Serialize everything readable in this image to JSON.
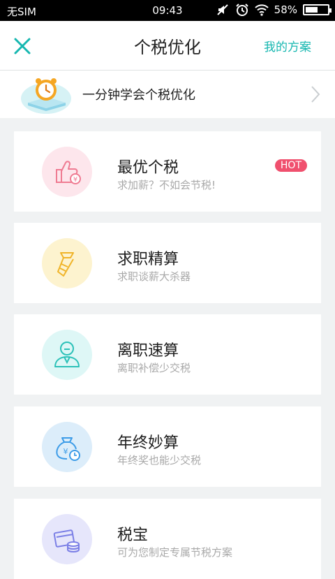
{
  "status_bar": {
    "carrier": "无SIM",
    "time": "09:43",
    "battery": "58%",
    "battery_level": 0.58
  },
  "header": {
    "title": "个税优化",
    "action": "我的方案",
    "close_icon": "close-icon"
  },
  "banner": {
    "text": "一分钟学会个税优化",
    "icon": "alarm-clock-book-icon"
  },
  "cards": [
    {
      "title": "最优个税",
      "subtitle": "求加薪？不如会节税!",
      "icon": "thumbs-up-coin-icon",
      "badge": "HOT",
      "color": "#fde6ec"
    },
    {
      "title": "求职精算",
      "subtitle": "求职谈薪大杀器",
      "icon": "tie-icon",
      "color": "#fdf3cf"
    },
    {
      "title": "离职速算",
      "subtitle": "离职补偿少交税",
      "icon": "person-icon",
      "color": "#def7f6"
    },
    {
      "title": "年终妙算",
      "subtitle": "年终奖也能少交税",
      "icon": "money-bag-clock-icon",
      "color": "#dcedfa"
    },
    {
      "title": "税宝",
      "subtitle": "可为您制定专属节税方案",
      "icon": "wallet-coins-icon",
      "color": "#e6e6fb"
    }
  ],
  "colors": {
    "accent": "#16b7b0",
    "hot": "#f0506e"
  }
}
